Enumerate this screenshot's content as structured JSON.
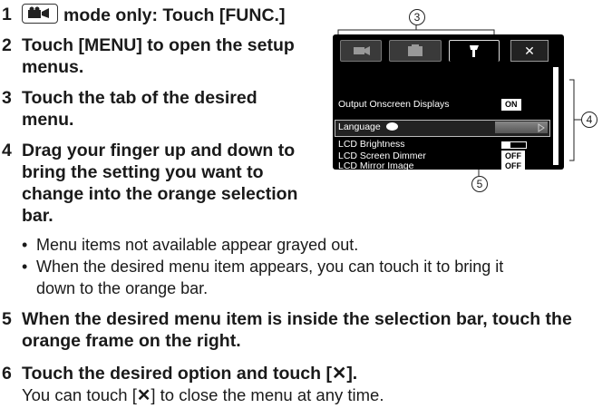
{
  "steps": [
    {
      "num": "1",
      "lines": [
        "mode only: Touch [FUNC.]"
      ]
    },
    {
      "num": "2",
      "lines": [
        "Touch [MENU] to open the setup",
        "menus."
      ]
    },
    {
      "num": "3",
      "lines": [
        "Touch the tab of the desired",
        "menu."
      ]
    },
    {
      "num": "4",
      "lines": [
        "Drag your finger up and down to",
        "bring the setting you want to",
        "change into the orange selection",
        "bar."
      ]
    },
    {
      "num": "5",
      "lines": [
        "When the desired menu item is inside the selection bar, touch the",
        "orange frame on the right."
      ]
    },
    {
      "num": "6",
      "lines": [
        "Touch the desired option and touch [",
        "]."
      ]
    }
  ],
  "bullets": [
    {
      "lines": [
        "Menu items not available appear grayed out."
      ]
    },
    {
      "lines": [
        "When the desired menu item appears, you can touch it to bring it",
        "down to the orange bar."
      ]
    }
  ],
  "note": {
    "before": "You can touch [",
    "after": "] to close the menu at any time."
  },
  "x_symbol": "✕",
  "bullet_symbol": "•",
  "callouts": {
    "c3": "3",
    "c4": "4",
    "c5": "5"
  },
  "screen": {
    "close": "✕",
    "rows": [
      {
        "label": "Output Onscreen Displays",
        "badge": "ON"
      },
      {
        "label": "Language",
        "badge": ""
      },
      {
        "label": "LCD Brightness",
        "badge": ""
      },
      {
        "label": "LCD Screen Dimmer",
        "badge": "OFF"
      },
      {
        "label": "LCD Mirror Image",
        "badge": "OFF"
      }
    ]
  }
}
